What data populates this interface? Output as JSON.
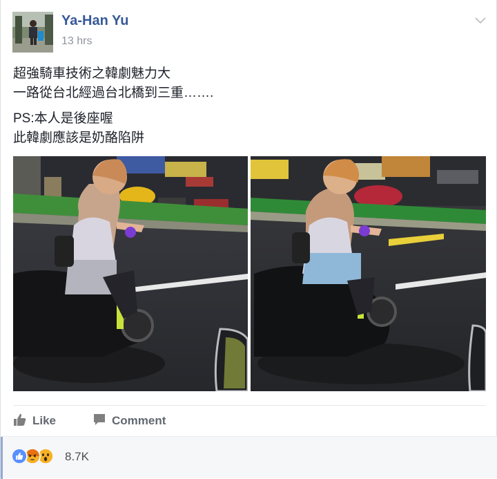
{
  "post": {
    "author": "Ya-Han Yu",
    "timestamp": "13 hrs",
    "text_lines_1": [
      "超強騎車技術之韓劇魅力大",
      "一路從台北經過台北橋到三重……."
    ],
    "text_lines_2": [
      "PS:本人是後座喔",
      "此韓劇應該是奶酪陷阱"
    ],
    "menu_icon": "chevron-down-icon"
  },
  "actions": {
    "like_label": "Like",
    "comment_label": "Comment"
  },
  "reactions": {
    "icons": [
      "like-reaction-icon",
      "angry-reaction-icon",
      "wow-reaction-icon"
    ],
    "count": "8.7K"
  },
  "colors": {
    "name": "#365899",
    "secondary": "#90949c",
    "action": "#616770",
    "like_blue": "#5890ff",
    "angry": "#e9710f",
    "wow": "#f7b125"
  }
}
